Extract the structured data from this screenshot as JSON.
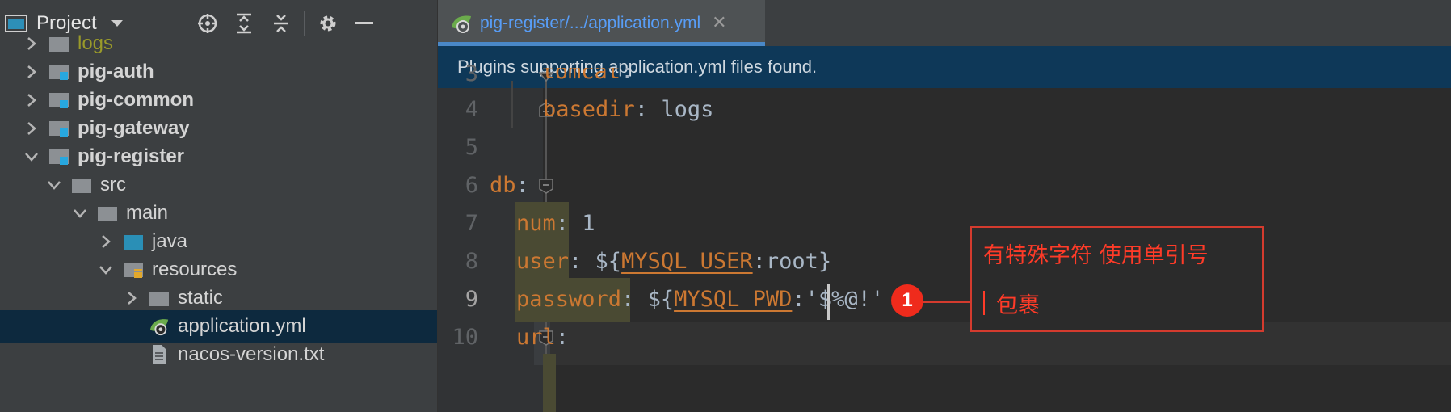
{
  "project_panel": {
    "title": "Project",
    "tree": [
      {
        "label": "logs",
        "bold": false
      },
      {
        "label": "pig-auth",
        "bold": true
      },
      {
        "label": "pig-common",
        "bold": true
      },
      {
        "label": "pig-gateway",
        "bold": true
      },
      {
        "label": "pig-register",
        "bold": true
      },
      {
        "label": "src",
        "bold": false
      },
      {
        "label": "main",
        "bold": false
      },
      {
        "label": "java",
        "bold": false
      },
      {
        "label": "resources",
        "bold": false
      },
      {
        "label": "static",
        "bold": false
      },
      {
        "label": "application.yml",
        "bold": false,
        "selected": true
      },
      {
        "label": "nacos-version.txt",
        "bold": false
      }
    ]
  },
  "editor": {
    "tab_title": "pig-register/.../application.yml",
    "banner": "Plugins supporting application.yml files found.",
    "line_numbers": [
      "3",
      "4",
      "5",
      "6",
      "7",
      "8",
      "9",
      "10"
    ],
    "current_line": "9",
    "code": {
      "line3_key": "tomcat",
      "line4_key": "basedir",
      "line4_value": "logs",
      "line6_key": "db",
      "line7_key": "num",
      "line7_value": "1",
      "line8_key": "user",
      "line8_prefix": "${",
      "line8_env": "MYSQL_USER",
      "line8_suffix": ":root}",
      "line9_key": "password",
      "line9_prefix": "${",
      "line9_env": "MYSQL_PWD",
      "line9_suffix": ":'$%@!'",
      "line10_key": "url"
    }
  },
  "annotation": {
    "badge": "1",
    "line1": "有特殊字符 使用单引号",
    "line2": "包裹"
  },
  "colors": {
    "accent": "#4a88c7",
    "keyword": "#cc7832",
    "annotation_red": "#ff3b28",
    "selection": "#0d293e"
  }
}
